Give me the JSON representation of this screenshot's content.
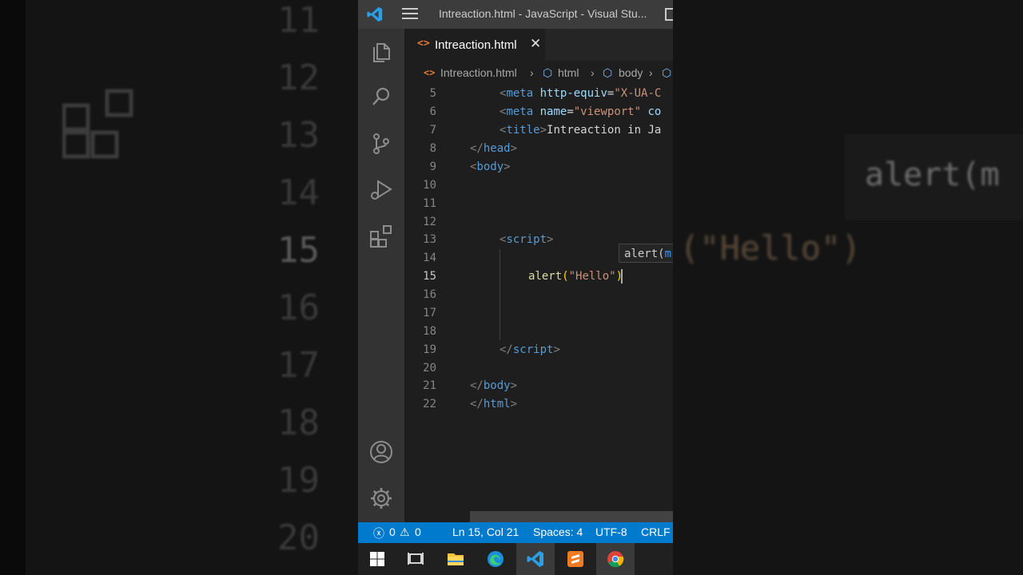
{
  "background": {
    "left_line_numbers": [
      "11",
      "12",
      "13",
      "14",
      "15",
      "16",
      "17",
      "18",
      "19",
      "20"
    ],
    "right_zoom_hint": "alert(m",
    "right_zoom_code": "(\"Hello\")"
  },
  "window": {
    "title": "Intreaction.html - JavaScript - Visual Stu..."
  },
  "tab": {
    "label": "Intreaction.html",
    "icon": "<>",
    "close": "✕"
  },
  "breadcrumb": {
    "file": "Intreaction.html",
    "html": "html",
    "body": "body"
  },
  "editor": {
    "lines": [
      {
        "n": "5"
      },
      {
        "n": "6"
      },
      {
        "n": "7"
      },
      {
        "n": "8"
      },
      {
        "n": "9"
      },
      {
        "n": "10"
      },
      {
        "n": "11"
      },
      {
        "n": "12"
      },
      {
        "n": "13"
      },
      {
        "n": "14"
      },
      {
        "n": "15"
      },
      {
        "n": "16"
      },
      {
        "n": "17"
      },
      {
        "n": "18"
      },
      {
        "n": "19"
      },
      {
        "n": "20"
      },
      {
        "n": "21"
      },
      {
        "n": "22"
      }
    ],
    "code": {
      "l5_tag": "meta",
      "l5_attr": "http-equiv",
      "l5_val": "\"X-UA-C",
      "l6_tag": "meta",
      "l6_attr": "name",
      "l6_val": "\"viewport\"",
      "l6_attr2": "co",
      "l7_tag": "title",
      "l7_text": "Intreaction in Ja",
      "l8_tag": "head",
      "l9_tag": "body",
      "l13_tag": "script",
      "l15_fn": "alert",
      "l15_str": "\"Hello\"",
      "l19_tag": "script",
      "l21_tag": "body",
      "l22_tag": "html"
    },
    "parameter_hint": "alert(",
    "parameter_hint_param": "m"
  },
  "status": {
    "errors": "0",
    "warnings": "0",
    "position": "Ln 15, Col 21",
    "spaces": "Spaces: 4",
    "encoding": "UTF-8",
    "eol": "CRLF"
  },
  "colors": {
    "accent": "#007acc",
    "editor_bg": "#1e1e1e",
    "activitybar_bg": "#333333"
  }
}
